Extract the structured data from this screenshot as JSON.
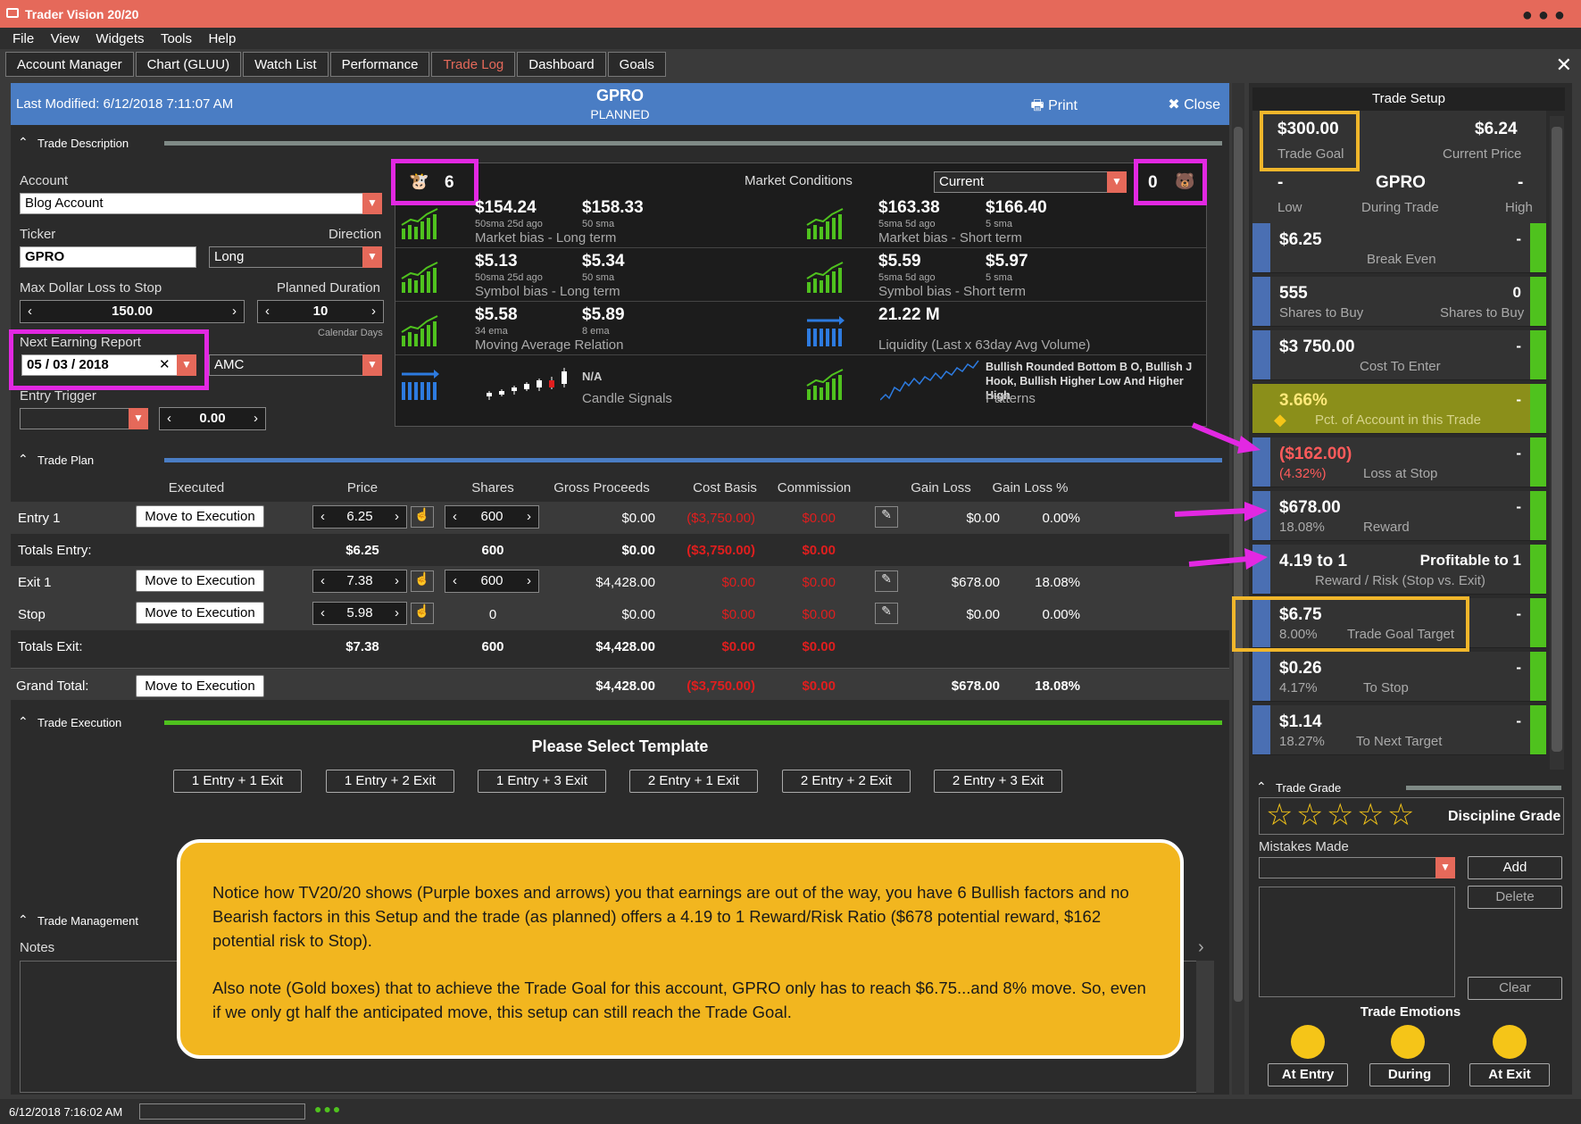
{
  "app": {
    "title": "Trader Vision 20/20"
  },
  "menu": [
    "File",
    "View",
    "Widgets",
    "Tools",
    "Help"
  ],
  "tabs": [
    "Account Manager",
    "Chart (GLUU)",
    "Watch List",
    "Performance",
    "Trade Log",
    "Dashboard",
    "Goals"
  ],
  "active_tab": "Trade Log",
  "header": {
    "last_modified": "Last Modified: 6/12/2018 7:11:07 AM",
    "symbol": "GPRO",
    "status": "PLANNED",
    "print": "Print",
    "close": "Close"
  },
  "trade_description": {
    "section": "Trade Description",
    "account_label": "Account",
    "account": "Blog Account",
    "ticker_label": "Ticker",
    "ticker": "GPRO",
    "direction_label": "Direction",
    "direction": "Long",
    "max_loss_label": "Max Dollar Loss to Stop",
    "max_loss": "150.00",
    "duration_label": "Planned Duration",
    "duration": "10",
    "duration_unit": "Calendar Days",
    "earning_label": "Next Earning Report",
    "earning_date": "05 / 03 / 2018",
    "earning_time": "AMC",
    "entry_trigger_label": "Entry Trigger",
    "entry_trigger_value": "0.00"
  },
  "market": {
    "bull_count": "6",
    "bear_count": "0",
    "label": "Market Conditions",
    "selector": "Current",
    "cells": [
      {
        "v1": "$154.24",
        "s1": "50sma 25d ago",
        "v2": "$158.33",
        "s2": "50 sma",
        "cap": "Market bias - Long term"
      },
      {
        "v1": "$163.38",
        "s1": "5sma 5d ago",
        "v2": "$166.40",
        "s2": "5 sma",
        "cap": "Market bias - Short term"
      },
      {
        "v1": "$5.13",
        "s1": "50sma 25d ago",
        "v2": "$5.34",
        "s2": "50 sma",
        "cap": "Symbol bias - Long term"
      },
      {
        "v1": "$5.59",
        "s1": "5sma 5d ago",
        "v2": "$5.97",
        "s2": "5 sma",
        "cap": "Symbol bias - Short term"
      },
      {
        "v1": "$5.58",
        "s1": "34 ema",
        "v2": "$5.89",
        "s2": "8 ema",
        "cap": "Moving Average Relation"
      },
      {
        "v1": "21.22 M",
        "s1": "",
        "v2": "",
        "s2": "",
        "cap": "Liquidity (Last x 63day Avg Volume)"
      }
    ],
    "candle_value": "N/A",
    "candle_cap": "Candle Signals",
    "patterns_text": "Bullish Rounded Bottom B O, Bullish J Hook, Bullish Higher Low And Higher High",
    "patterns_cap": "Patterns"
  },
  "trade_plan": {
    "section": "Trade Plan",
    "headers": [
      "Executed",
      "Price",
      "Shares",
      "Gross Proceeds",
      "Cost Basis",
      "Commission",
      "Gain Loss",
      "Gain Loss %"
    ],
    "move_label": "Move to Execution",
    "entry1": {
      "label": "Entry 1",
      "price": "6.25",
      "shares": "600",
      "gross": "$0.00",
      "basis": "($3,750.00)",
      "comm": "$0.00",
      "gain": "$0.00",
      "pct": "0.00%"
    },
    "totals_entry": {
      "label": "Totals Entry:",
      "price": "$6.25",
      "shares": "600",
      "gross": "$0.00",
      "basis": "($3,750.00)",
      "comm": "$0.00"
    },
    "exit1": {
      "label": "Exit 1",
      "price": "7.38",
      "shares": "600",
      "gross": "$4,428.00",
      "basis": "$0.00",
      "comm": "$0.00",
      "gain": "$678.00",
      "pct": "18.08%"
    },
    "stop": {
      "label": "Stop",
      "price": "5.98",
      "shares": "0",
      "gross": "$0.00",
      "basis": "$0.00",
      "comm": "$0.00",
      "gain": "$0.00",
      "pct": "0.00%"
    },
    "totals_exit": {
      "label": "Totals Exit:",
      "price": "$7.38",
      "shares": "600",
      "gross": "$4,428.00",
      "basis": "$0.00",
      "comm": "$0.00"
    },
    "grand": {
      "label": "Grand Total:",
      "gross": "$4,428.00",
      "basis": "($3,750.00)",
      "comm": "$0.00",
      "gain": "$678.00",
      "pct": "18.08%"
    }
  },
  "trade_execution": {
    "section": "Trade Execution",
    "prompt": "Please Select Template",
    "templates": [
      "1 Entry + 1 Exit",
      "1 Entry + 2 Exit",
      "1 Entry + 3 Exit",
      "2 Entry + 1 Exit",
      "2 Entry + 2 Exit",
      "2 Entry + 3 Exit"
    ]
  },
  "trade_management": {
    "section": "Trade Management",
    "notes": "Notes"
  },
  "note": {
    "p1": "Notice how TV20/20 shows (Purple boxes and arrows) you that earnings are out of the way, you have 6 Bullish factors and no Bearish factors in this Setup and the trade (as planned) offers a 4.19 to 1 Reward/Risk Ratio ($678 potential reward, $162 potential risk to Stop).",
    "p2": "Also note (Gold boxes) that to achieve the Trade Goal for this account, GPRO only has to reach $6.75...and 8% move.  So, even if we only gt half the anticipated move, this setup can still reach the Trade Goal."
  },
  "setup": {
    "title": "Trade Setup",
    "goal": "$300.00",
    "goal_cap": "Trade Goal",
    "price": "$6.24",
    "price_cap": "Current Price",
    "low": "-",
    "low_cap": "Low",
    "sym": "GPRO",
    "during_cap": "During Trade",
    "high": "-",
    "high_cap": "High",
    "rows": [
      {
        "v": "$6.25",
        "rv": "-",
        "c1": "",
        "c2": "Break Even"
      },
      {
        "v": "555",
        "rv": "0",
        "c1": "Shares to Buy",
        "c2": "Shares to Buy"
      },
      {
        "v": "$3 750.00",
        "rv": "-",
        "c1": "",
        "c2": "Cost To Enter"
      },
      {
        "v": "3.66%",
        "rv": "-",
        "c1": "",
        "c2": "Pct. of Account in this Trade"
      },
      {
        "v": "($162.00)",
        "rv": "-",
        "c1": "(4.32%)",
        "c2": "Loss at Stop"
      },
      {
        "v": "$678.00",
        "rv": "-",
        "c1": "18.08%",
        "c2": "Reward"
      },
      {
        "v": "4.19 to 1",
        "rv": "Profitable to 1",
        "c1": "",
        "c2": "Reward / Risk (Stop vs. Exit)"
      },
      {
        "v": "$6.75",
        "rv": "-",
        "c1": "8.00%",
        "c2": "Trade Goal Target"
      },
      {
        "v": "$0.26",
        "rv": "-",
        "c1": "4.17%",
        "c2": "To Stop"
      },
      {
        "v": "$1.14",
        "rv": "-",
        "c1": "18.27%",
        "c2": "To Next Target"
      }
    ]
  },
  "grade": {
    "section": "Trade Grade",
    "discipline": "Discipline Grade",
    "mistakes": "Mistakes Made",
    "add": "Add",
    "delete": "Delete",
    "clear": "Clear",
    "emotions": "Trade Emotions",
    "at_entry": "At Entry",
    "during": "During",
    "at_exit": "At Exit"
  },
  "status": {
    "time": "6/12/2018 7:16:02 AM"
  },
  "colors": {
    "title": "#e5695a",
    "header": "#4a7dc4",
    "bull_green": "#4fc21e",
    "purple": "#e228e2",
    "gold": "#f0b62b"
  }
}
